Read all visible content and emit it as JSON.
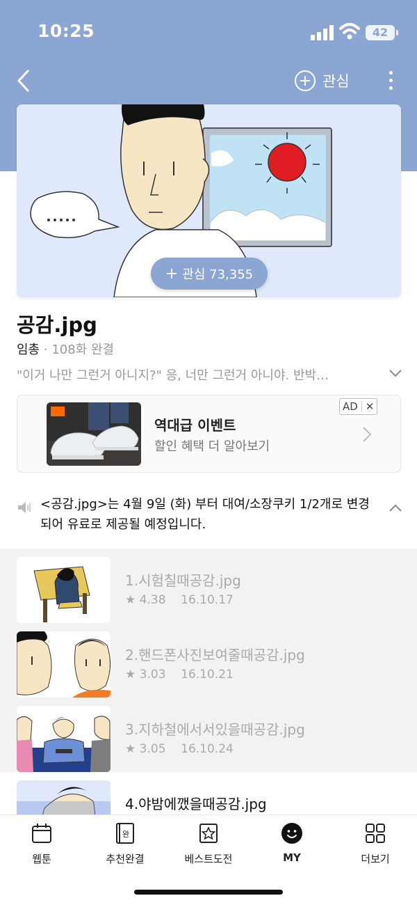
{
  "status_bar": {
    "time": "10:25",
    "battery": "42"
  },
  "header": {
    "follow_label": "관심"
  },
  "hero": {
    "follow_count_label": "관심 73,355",
    "follow_plus": "+"
  },
  "series": {
    "title": "공감.jpg",
    "author": "임총",
    "separator": "·",
    "episode_info": "108화 완결",
    "description": "\"이거 나만 그런거 아니지?\" 응, 너만 그런거 아니야. 반박…"
  },
  "ad": {
    "title": "역대급 이벤트",
    "subtitle": "할인 혜택 더 알아보기",
    "badge": "AD",
    "close": "✕"
  },
  "notice": {
    "text": "<공감.jpg>는 4월 9일 (화) 부터 대여/소장쿠키 1/2개로 변경되어 유료로 제공될 예정입니다."
  },
  "episodes": [
    {
      "title": "1.시험칠때공감.jpg",
      "rating": "4.38",
      "date": "16.10.17",
      "read": true
    },
    {
      "title": "2.핸드폰사진보여줄때공감.jpg",
      "rating": "3.03",
      "date": "16.10.21",
      "read": true
    },
    {
      "title": "3.지하철에서서있을때공감.jpg",
      "rating": "3.05",
      "date": "16.10.24",
      "read": true
    },
    {
      "title": "4.야밤에깼을때공감.jpg",
      "rating": "",
      "date": "",
      "read": false
    }
  ],
  "rating_star": "★",
  "tabs": [
    {
      "label": "웹툰",
      "icon": "calendar-icon"
    },
    {
      "label": "추천완결",
      "icon": "book-icon"
    },
    {
      "label": "베스트도전",
      "icon": "star-frame-icon"
    },
    {
      "label": "MY",
      "icon": "smiley-icon"
    },
    {
      "label": "더보기",
      "icon": "grid-icon"
    }
  ],
  "tab_icon_text": {
    "completed": "완"
  },
  "colors": {
    "header_bg": "#8ca6d3",
    "list_bg": "#f2f2f2"
  }
}
